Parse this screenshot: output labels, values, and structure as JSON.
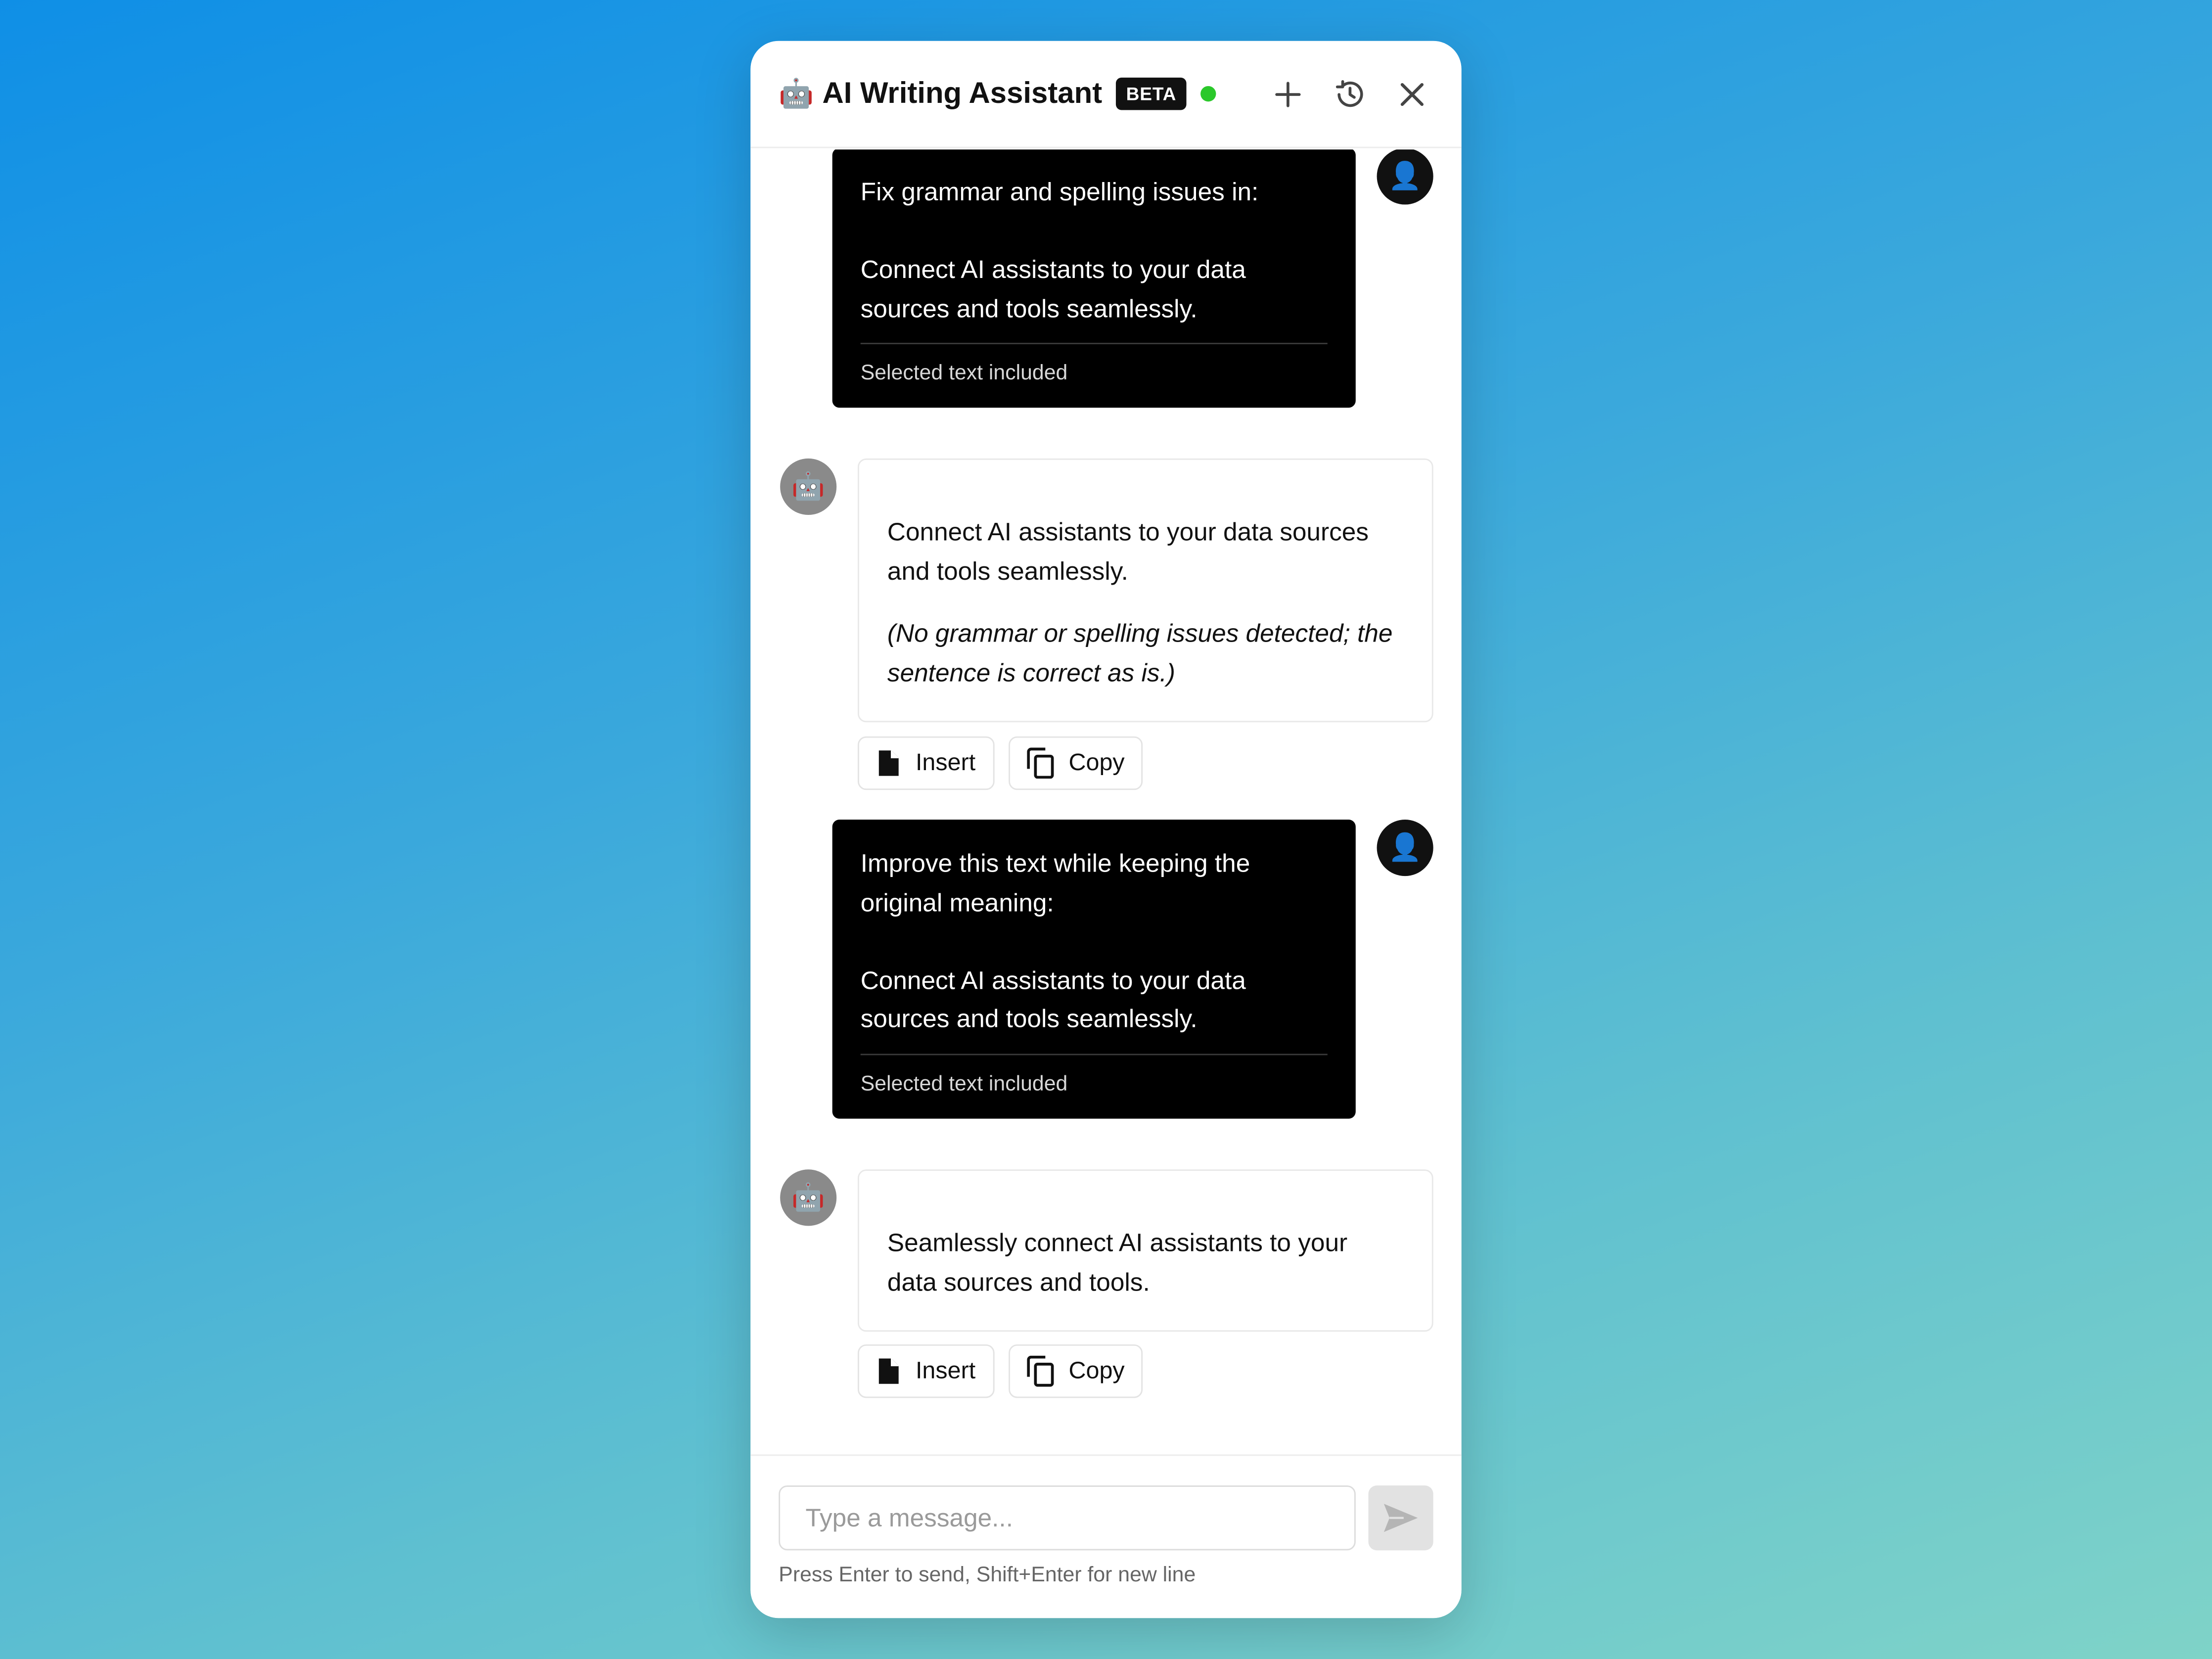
{
  "header": {
    "emoji": "🤖",
    "title": "AI Writing Assistant",
    "badge": "BETA",
    "status_color": "#2bc82b",
    "actions": [
      "plus-icon",
      "history-icon",
      "close-icon"
    ]
  },
  "messages": [
    {
      "role": "user",
      "text": "Fix grammar and spelling issues in:\n\nConnect AI assistants to your data sources and tools seamlessly.",
      "note": "Selected text included",
      "avatar": "👤"
    },
    {
      "role": "assistant",
      "avatar": "🤖",
      "text": "Connect AI assistants to your data sources and tools seamlessly.",
      "note": "(No grammar or spelling issues detected; the sentence is correct as is.)",
      "insert_label": "Insert",
      "copy_label": "Copy"
    },
    {
      "role": "user",
      "text": "Improve this text while keeping the original meaning:\n\nConnect AI assistants to your data sources and tools seamlessly.",
      "note": "Selected text included",
      "avatar": "👤"
    },
    {
      "role": "assistant",
      "avatar": "🤖",
      "text": "Seamlessly connect AI assistants to your data sources and tools.",
      "insert_label": "Insert",
      "copy_label": "Copy"
    }
  ],
  "composer": {
    "placeholder": "Type a message...",
    "value": "",
    "hint": "Press Enter to send, Shift+Enter for new line"
  }
}
